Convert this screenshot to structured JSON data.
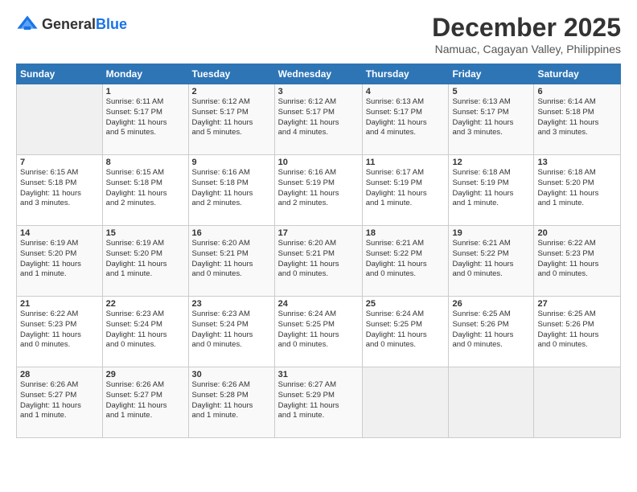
{
  "logo": {
    "text_general": "General",
    "text_blue": "Blue"
  },
  "title": "December 2025",
  "location": "Namuac, Cagayan Valley, Philippines",
  "days_of_week": [
    "Sunday",
    "Monday",
    "Tuesday",
    "Wednesday",
    "Thursday",
    "Friday",
    "Saturday"
  ],
  "weeks": [
    [
      {
        "day": "",
        "info": ""
      },
      {
        "day": "1",
        "info": "Sunrise: 6:11 AM\nSunset: 5:17 PM\nDaylight: 11 hours\nand 5 minutes."
      },
      {
        "day": "2",
        "info": "Sunrise: 6:12 AM\nSunset: 5:17 PM\nDaylight: 11 hours\nand 5 minutes."
      },
      {
        "day": "3",
        "info": "Sunrise: 6:12 AM\nSunset: 5:17 PM\nDaylight: 11 hours\nand 4 minutes."
      },
      {
        "day": "4",
        "info": "Sunrise: 6:13 AM\nSunset: 5:17 PM\nDaylight: 11 hours\nand 4 minutes."
      },
      {
        "day": "5",
        "info": "Sunrise: 6:13 AM\nSunset: 5:17 PM\nDaylight: 11 hours\nand 3 minutes."
      },
      {
        "day": "6",
        "info": "Sunrise: 6:14 AM\nSunset: 5:18 PM\nDaylight: 11 hours\nand 3 minutes."
      }
    ],
    [
      {
        "day": "7",
        "info": "Sunrise: 6:15 AM\nSunset: 5:18 PM\nDaylight: 11 hours\nand 3 minutes."
      },
      {
        "day": "8",
        "info": "Sunrise: 6:15 AM\nSunset: 5:18 PM\nDaylight: 11 hours\nand 2 minutes."
      },
      {
        "day": "9",
        "info": "Sunrise: 6:16 AM\nSunset: 5:18 PM\nDaylight: 11 hours\nand 2 minutes."
      },
      {
        "day": "10",
        "info": "Sunrise: 6:16 AM\nSunset: 5:19 PM\nDaylight: 11 hours\nand 2 minutes."
      },
      {
        "day": "11",
        "info": "Sunrise: 6:17 AM\nSunset: 5:19 PM\nDaylight: 11 hours\nand 1 minute."
      },
      {
        "day": "12",
        "info": "Sunrise: 6:18 AM\nSunset: 5:19 PM\nDaylight: 11 hours\nand 1 minute."
      },
      {
        "day": "13",
        "info": "Sunrise: 6:18 AM\nSunset: 5:20 PM\nDaylight: 11 hours\nand 1 minute."
      }
    ],
    [
      {
        "day": "14",
        "info": "Sunrise: 6:19 AM\nSunset: 5:20 PM\nDaylight: 11 hours\nand 1 minute."
      },
      {
        "day": "15",
        "info": "Sunrise: 6:19 AM\nSunset: 5:20 PM\nDaylight: 11 hours\nand 1 minute."
      },
      {
        "day": "16",
        "info": "Sunrise: 6:20 AM\nSunset: 5:21 PM\nDaylight: 11 hours\nand 0 minutes."
      },
      {
        "day": "17",
        "info": "Sunrise: 6:20 AM\nSunset: 5:21 PM\nDaylight: 11 hours\nand 0 minutes."
      },
      {
        "day": "18",
        "info": "Sunrise: 6:21 AM\nSunset: 5:22 PM\nDaylight: 11 hours\nand 0 minutes."
      },
      {
        "day": "19",
        "info": "Sunrise: 6:21 AM\nSunset: 5:22 PM\nDaylight: 11 hours\nand 0 minutes."
      },
      {
        "day": "20",
        "info": "Sunrise: 6:22 AM\nSunset: 5:23 PM\nDaylight: 11 hours\nand 0 minutes."
      }
    ],
    [
      {
        "day": "21",
        "info": "Sunrise: 6:22 AM\nSunset: 5:23 PM\nDaylight: 11 hours\nand 0 minutes."
      },
      {
        "day": "22",
        "info": "Sunrise: 6:23 AM\nSunset: 5:24 PM\nDaylight: 11 hours\nand 0 minutes."
      },
      {
        "day": "23",
        "info": "Sunrise: 6:23 AM\nSunset: 5:24 PM\nDaylight: 11 hours\nand 0 minutes."
      },
      {
        "day": "24",
        "info": "Sunrise: 6:24 AM\nSunset: 5:25 PM\nDaylight: 11 hours\nand 0 minutes."
      },
      {
        "day": "25",
        "info": "Sunrise: 6:24 AM\nSunset: 5:25 PM\nDaylight: 11 hours\nand 0 minutes."
      },
      {
        "day": "26",
        "info": "Sunrise: 6:25 AM\nSunset: 5:26 PM\nDaylight: 11 hours\nand 0 minutes."
      },
      {
        "day": "27",
        "info": "Sunrise: 6:25 AM\nSunset: 5:26 PM\nDaylight: 11 hours\nand 0 minutes."
      }
    ],
    [
      {
        "day": "28",
        "info": "Sunrise: 6:26 AM\nSunset: 5:27 PM\nDaylight: 11 hours\nand 1 minute."
      },
      {
        "day": "29",
        "info": "Sunrise: 6:26 AM\nSunset: 5:27 PM\nDaylight: 11 hours\nand 1 minute."
      },
      {
        "day": "30",
        "info": "Sunrise: 6:26 AM\nSunset: 5:28 PM\nDaylight: 11 hours\nand 1 minute."
      },
      {
        "day": "31",
        "info": "Sunrise: 6:27 AM\nSunset: 5:29 PM\nDaylight: 11 hours\nand 1 minute."
      },
      {
        "day": "",
        "info": ""
      },
      {
        "day": "",
        "info": ""
      },
      {
        "day": "",
        "info": ""
      }
    ]
  ]
}
